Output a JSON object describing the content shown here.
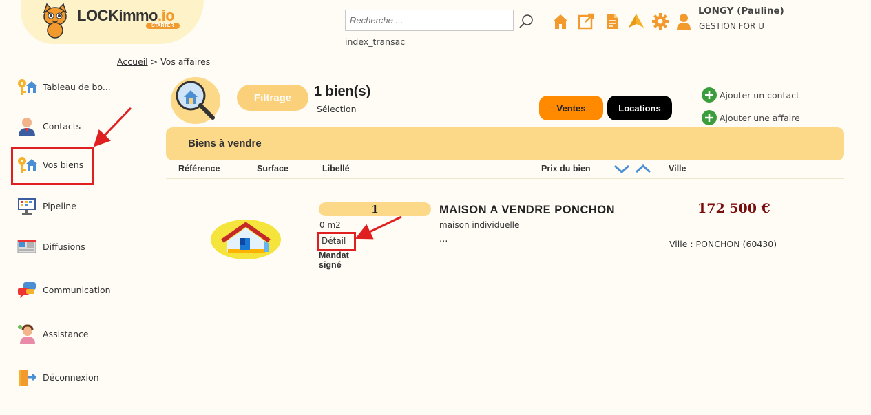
{
  "header": {
    "logo_main": "LOCKimmo",
    "logo_suffix": ".io",
    "logo_badge": "STARTER",
    "search_placeholder": "Recherche ...",
    "index_label": "index_transac",
    "user_name": "LONGY (Pauline)",
    "user_company": "GESTION FOR U",
    "icons": [
      "home-icon",
      "external-link-icon",
      "document-icon",
      "arrow-up-icon",
      "gear-icon",
      "user-icon"
    ],
    "accent_color": "#f29a2e"
  },
  "breadcrumb": {
    "home": "Accueil",
    "separator": ">",
    "current": "Vos affaires"
  },
  "sidebar": {
    "items": [
      {
        "label": "Tableau de bo...",
        "icon": "key-house-icon"
      },
      {
        "label": "Contacts",
        "icon": "person-icon"
      },
      {
        "label": "Vos biens",
        "icon": "key-house-icon"
      },
      {
        "label": "Pipeline",
        "icon": "pipeline-icon"
      },
      {
        "label": "Diffusions",
        "icon": "diffusion-icon"
      },
      {
        "label": "Communication",
        "icon": "chat-bubbles-icon"
      },
      {
        "label": "Assistance",
        "icon": "support-agent-icon"
      },
      {
        "label": "Déconnexion",
        "icon": "logout-icon"
      }
    ]
  },
  "main": {
    "filter_label": "Filtrage",
    "count_label": "1 bien(s)",
    "selection_label": "Sélection",
    "ventes_label": "Ventes",
    "locations_label": "Locations",
    "add_contact": "Ajouter un contact",
    "add_affaire": "Ajouter une affaire",
    "banner_title": "Biens à vendre",
    "columns": [
      "Référence",
      "Surface",
      "Libellé",
      "Prix du bien",
      "Ville"
    ],
    "row": {
      "reference": "1",
      "surface": "0 m2",
      "detail": "Détail",
      "mandat": "Mandat signé",
      "title": "MAISON A VENDRE PONCHON",
      "type": "maison individuelle",
      "more": "...",
      "price": "172 500 €",
      "city": "Ville : PONCHON (60430)"
    }
  },
  "colors": {
    "banner": "#fbd989",
    "filter": "#fbd07a",
    "ventes": "#ff8a00",
    "locations": "#000000",
    "price": "#7a0e0e",
    "annotation": "#e02020"
  }
}
